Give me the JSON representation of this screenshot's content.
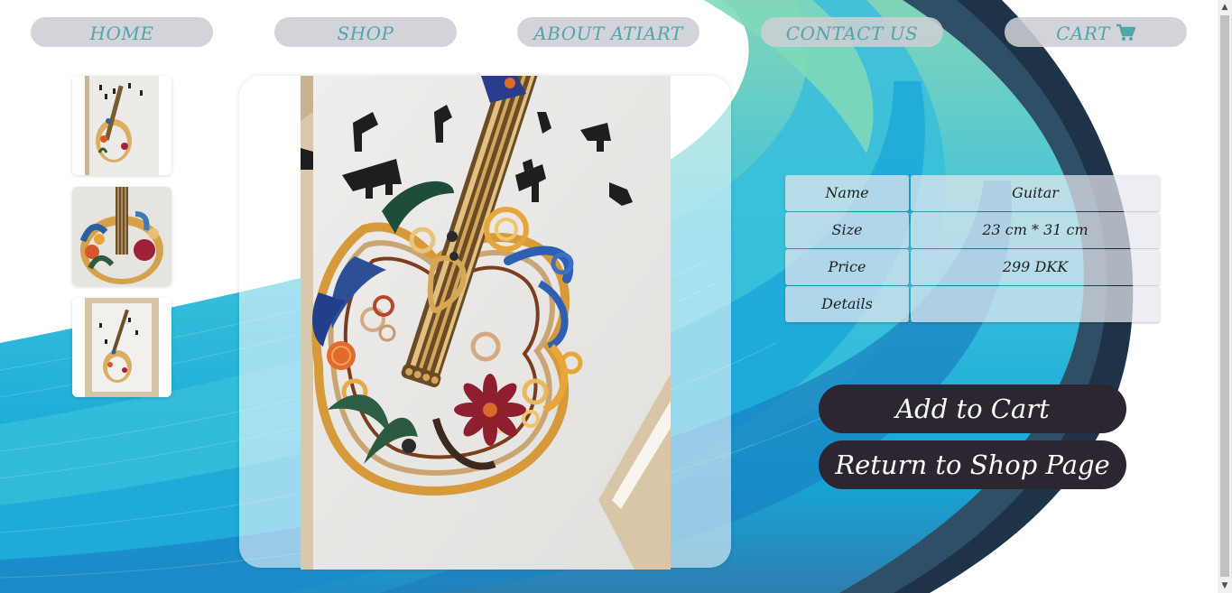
{
  "nav": {
    "items": [
      {
        "label": "HOME"
      },
      {
        "label": "SHOP"
      },
      {
        "label": "ABOUT ATIART"
      },
      {
        "label": "CONTACT US"
      },
      {
        "label": "CART"
      }
    ],
    "cart_icon": "shopping-cart-icon",
    "text_color": "#52a4ab"
  },
  "thumbnails": [
    {
      "alt": "guitar-quilling-thumbnail-1"
    },
    {
      "alt": "guitar-quilling-thumbnail-2"
    },
    {
      "alt": "guitar-quilling-thumbnail-3"
    }
  ],
  "product": {
    "labels": {
      "name": "Name",
      "size": "Size",
      "price": "Price",
      "details": "Details"
    },
    "name": "Guitar",
    "size": "23 cm * 31 cm",
    "price": "299 DKK",
    "details": ""
  },
  "actions": {
    "add_to_cart": "Add to Cart",
    "return_to_shop": "Return to Shop Page"
  },
  "colors": {
    "button_bg": "#2b2630",
    "button_text": "#ffffff"
  }
}
